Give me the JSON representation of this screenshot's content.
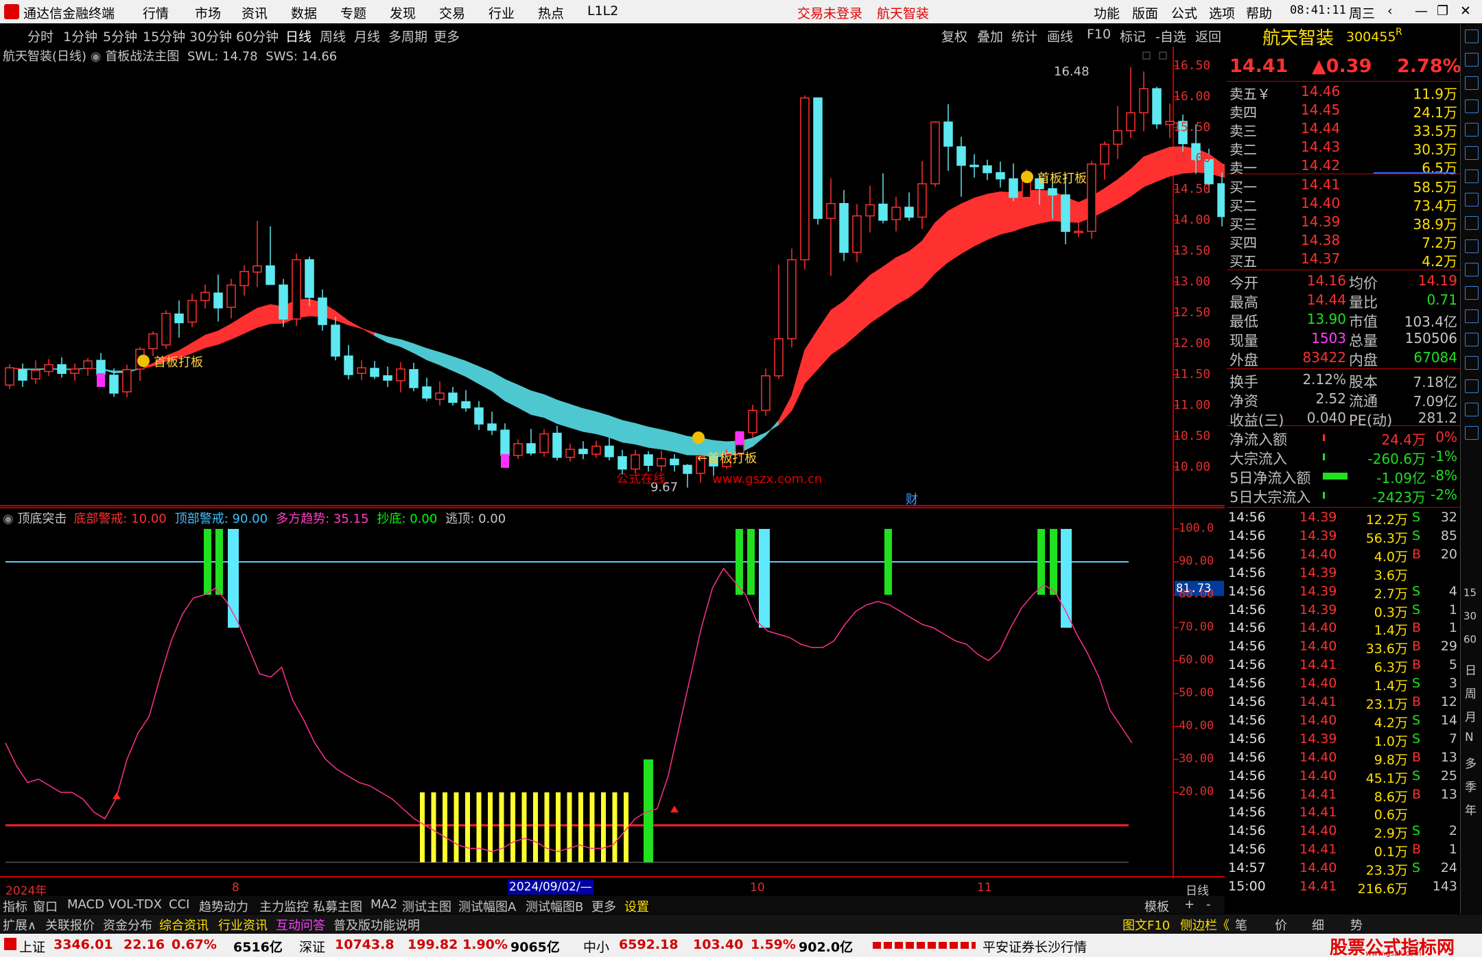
{
  "titlebar": {
    "app": "通达信金融终端",
    "menu": [
      "行情",
      "市场",
      "资讯",
      "数据",
      "专题",
      "发现",
      "交易",
      "行业",
      "热点",
      "L1L2"
    ],
    "trade_status": "交易未登录",
    "stock_name": "航天智装",
    "right_menu": [
      "功能",
      "版面",
      "公式",
      "选项",
      "帮助"
    ],
    "time": "08:41:11",
    "weekday": "周三"
  },
  "periods": [
    "分时",
    "1分钟",
    "5分钟",
    "15分钟",
    "30分钟",
    "60分钟",
    "日线",
    "周线",
    "月线",
    "多周期",
    "更多"
  ],
  "tools": [
    "复权",
    "叠加",
    "统计",
    "画线",
    "F10",
    "标记",
    "-自选",
    "返回"
  ],
  "chart": {
    "title": "航天智装(日线)",
    "formula": "首板战法主图",
    "swl": "SWL: 14.78",
    "sws": "SWS: 14.66",
    "high_label": "16.48",
    "low_label": "9.67",
    "signal": "首板打板",
    "signal_left": "←首板打板",
    "watermark_cn": "公式在线",
    "watermark_url": "www.gszx.com.cn",
    "cai": "财",
    "price_axis": [
      "16.50",
      "16.00",
      "15.50",
      "15.00",
      "14.50",
      "14.00",
      "13.50",
      "13.00",
      "12.50",
      "12.00",
      "11.50",
      "11.00",
      "10.50",
      "10.00"
    ]
  },
  "indicator": {
    "name": "顶底突击",
    "vals": [
      {
        "t": "底部警戒: 10.00",
        "c": "#ff3030"
      },
      {
        "t": "顶部警戒: 90.00",
        "c": "#40c0ff"
      },
      {
        "t": "多方趋势: 35.15",
        "c": "#ff40c0"
      },
      {
        "t": "抄底: 0.00",
        "c": "#00ff00"
      },
      {
        "t": "逃顶: 0.00",
        "c": "#c8c8c8"
      }
    ],
    "axis": [
      "100.0",
      "90.00",
      "80.00",
      "70.00",
      "60.00",
      "50.00",
      "40.00",
      "30.00",
      "20.00"
    ],
    "current": "81.73"
  },
  "dates": {
    "year": "2024年",
    "m8": "8",
    "sel": "2024/09/02/—",
    "m10": "10",
    "m11": "11",
    "period": "日线"
  },
  "tabs": [
    "指标",
    "窗口",
    "MACD",
    "VOL-TDX",
    "CCI",
    "趋势动力",
    "主力监控",
    "私募主图",
    "MA2",
    "测试主图",
    "测试幅图A",
    "测试幅图B",
    "更多",
    "设置"
  ],
  "tabs_right": [
    "模板",
    "+",
    "-"
  ],
  "bottom_tabs": [
    "扩展∧",
    "关联报价",
    "资金分布",
    "综合资讯",
    "行业资讯",
    "互动问答",
    "普及版功能说明"
  ],
  "bottom_right": [
    "图文F10",
    "侧边栏《",
    "笔",
    "价",
    "细",
    "势"
  ],
  "indices": [
    {
      "n": "上证",
      "v": "3346.01",
      "c": "22.16",
      "p": "0.67%",
      "a": "6516亿"
    },
    {
      "n": "深证",
      "v": "10743.8",
      "c": "199.82",
      "p": "1.90%",
      "a": "9065亿"
    },
    {
      "n": "中小",
      "v": "6592.18",
      "c": "103.40",
      "p": "1.59%",
      "a": "902.0亿"
    }
  ],
  "broker": "平安证券长沙行情",
  "logo": {
    "cn": "股票公式指标网",
    "url": "www.gszx.com"
  },
  "quote": {
    "name": "航天智装",
    "code": "300455",
    "flag": "R",
    "price": "14.41",
    "change": "▲0.39",
    "pct": "2.78%",
    "sells": [
      {
        "l": "卖五￥",
        "p": "14.46",
        "v": "11.9万"
      },
      {
        "l": "卖四",
        "p": "14.45",
        "v": "24.1万"
      },
      {
        "l": "卖三",
        "p": "14.44",
        "v": "33.5万"
      },
      {
        "l": "卖二",
        "p": "14.43",
        "v": "30.3万"
      },
      {
        "l": "卖一",
        "p": "14.42",
        "v": "6.5万"
      }
    ],
    "buys": [
      {
        "l": "买一",
        "p": "14.41",
        "v": "58.5万"
      },
      {
        "l": "买二",
        "p": "14.40",
        "v": "73.4万"
      },
      {
        "l": "买三",
        "p": "14.39",
        "v": "38.9万"
      },
      {
        "l": "买四",
        "p": "14.38",
        "v": "7.2万"
      },
      {
        "l": "买五",
        "p": "14.37",
        "v": "4.2万"
      }
    ],
    "stats": [
      [
        "今开",
        "14.16",
        "均价",
        "14.19"
      ],
      [
        "最高",
        "14.44",
        "量比",
        "0.71"
      ],
      [
        "最低",
        "13.90",
        "市值",
        "103.4亿"
      ],
      [
        "现量",
        "1503",
        "总量",
        "150506"
      ],
      [
        "外盘",
        "83422",
        "内盘",
        "67084"
      ]
    ],
    "stats2": [
      [
        "换手",
        "2.12%",
        "股本",
        "7.18亿"
      ],
      [
        "净资",
        "2.52",
        "流通",
        "7.09亿"
      ],
      [
        "收益(三)",
        "0.040",
        "PE(动)",
        "281.2"
      ]
    ],
    "flows": [
      [
        "净流入额",
        "24.4万",
        "0%"
      ],
      [
        "大宗流入",
        "-260.6万",
        "-1%"
      ],
      [
        "5日净流入额",
        "-1.09亿",
        "-8%"
      ],
      [
        "5日大宗流入",
        "-2423万",
        "-2%"
      ]
    ],
    "ticks": [
      [
        "14:56",
        "14.39",
        "12.2万",
        "S",
        "32"
      ],
      [
        "14:56",
        "14.39",
        "56.3万",
        "S",
        "85"
      ],
      [
        "14:56",
        "14.40",
        "4.0万",
        "B",
        "20"
      ],
      [
        "14:56",
        "14.39",
        "3.6万",
        "",
        ""
      ],
      [
        "14:56",
        "14.39",
        "2.7万",
        "S",
        "4"
      ],
      [
        "14:56",
        "14.39",
        "0.3万",
        "S",
        "1"
      ],
      [
        "14:56",
        "14.40",
        "1.4万",
        "B",
        "1"
      ],
      [
        "14:56",
        "14.40",
        "33.6万",
        "B",
        "29"
      ],
      [
        "14:56",
        "14.41",
        "6.3万",
        "B",
        "5"
      ],
      [
        "14:56",
        "14.40",
        "1.4万",
        "S",
        "3"
      ],
      [
        "14:56",
        "14.41",
        "23.1万",
        "B",
        "12"
      ],
      [
        "14:56",
        "14.40",
        "4.2万",
        "S",
        "14"
      ],
      [
        "14:56",
        "14.39",
        "1.0万",
        "S",
        "7"
      ],
      [
        "14:56",
        "14.40",
        "9.8万",
        "B",
        "13"
      ],
      [
        "14:56",
        "14.40",
        "45.1万",
        "S",
        "25"
      ],
      [
        "14:56",
        "14.41",
        "8.6万",
        "B",
        "13"
      ],
      [
        "14:56",
        "14.41",
        "0.6万",
        "",
        ""
      ],
      [
        "14:56",
        "14.40",
        "2.9万",
        "S",
        "2"
      ],
      [
        "14:56",
        "14.41",
        "0.1万",
        "B",
        "1"
      ],
      [
        "14:57",
        "14.40",
        "23.3万",
        "S",
        "24"
      ],
      [
        "15:00",
        "14.41",
        "216.6万",
        "",
        "143"
      ]
    ]
  },
  "side_icons": [
    "日",
    "周",
    "月",
    "N",
    "多",
    "季",
    "年"
  ],
  "side_nums": [
    "15",
    "30",
    "60"
  ],
  "chart_data": {
    "type": "candlestick",
    "series": [
      [
        11.33,
        11.67,
        11.27,
        11.61
      ],
      [
        11.58,
        11.68,
        11.3,
        11.41
      ],
      [
        11.43,
        11.73,
        11.35,
        11.57
      ],
      [
        11.55,
        11.75,
        11.48,
        11.66
      ],
      [
        11.66,
        11.78,
        11.45,
        11.52
      ],
      [
        11.52,
        11.68,
        11.4,
        11.59
      ],
      [
        11.6,
        11.77,
        11.48,
        11.72
      ],
      [
        11.73,
        11.85,
        11.41,
        11.5
      ],
      [
        11.49,
        11.6,
        11.14,
        11.2
      ],
      [
        11.22,
        11.66,
        11.13,
        11.58
      ],
      [
        11.59,
        11.95,
        11.4,
        11.91
      ],
      [
        11.92,
        12.2,
        11.8,
        12.16
      ],
      [
        11.98,
        12.54,
        11.92,
        12.49
      ],
      [
        12.48,
        12.7,
        12.1,
        12.34
      ],
      [
        12.35,
        12.81,
        12.27,
        12.7
      ],
      [
        12.7,
        12.96,
        12.57,
        12.83
      ],
      [
        12.82,
        13.12,
        12.36,
        12.58
      ],
      [
        12.59,
        13.05,
        12.41,
        12.95
      ],
      [
        12.94,
        13.27,
        12.78,
        13.17
      ],
      [
        13.16,
        13.99,
        12.92,
        13.26
      ],
      [
        13.26,
        13.9,
        13.18,
        12.96
      ],
      [
        12.95,
        13.05,
        12.27,
        12.4
      ],
      [
        12.4,
        13.46,
        12.29,
        13.36
      ],
      [
        13.36,
        13.41,
        12.61,
        12.75
      ],
      [
        12.74,
        12.88,
        12.21,
        12.31
      ],
      [
        12.3,
        12.44,
        11.73,
        11.8
      ],
      [
        11.8,
        11.98,
        11.42,
        11.5
      ],
      [
        11.52,
        11.73,
        11.41,
        11.61
      ],
      [
        11.6,
        11.72,
        11.43,
        11.47
      ],
      [
        11.48,
        11.63,
        11.3,
        11.41
      ],
      [
        11.4,
        11.7,
        11.21,
        11.59
      ],
      [
        11.58,
        11.69,
        11.23,
        11.29
      ],
      [
        11.3,
        11.45,
        11.07,
        11.12
      ],
      [
        11.1,
        11.39,
        11.0,
        11.2
      ],
      [
        11.2,
        11.3,
        11.0,
        11.05
      ],
      [
        11.06,
        11.25,
        10.9,
        10.96
      ],
      [
        10.96,
        11.07,
        10.6,
        10.7
      ],
      [
        10.7,
        10.9,
        10.52,
        10.6
      ],
      [
        10.6,
        10.71,
        10.1,
        10.19
      ],
      [
        10.19,
        10.45,
        10.13,
        10.38
      ],
      [
        10.38,
        10.62,
        10.19,
        10.23
      ],
      [
        10.24,
        10.62,
        10.17,
        10.54
      ],
      [
        10.55,
        10.67,
        10.11,
        10.16
      ],
      [
        10.16,
        10.38,
        10.09,
        10.29
      ],
      [
        10.29,
        10.42,
        10.13,
        10.22
      ],
      [
        10.21,
        10.43,
        10.15,
        10.34
      ],
      [
        10.34,
        10.48,
        10.11,
        10.17
      ],
      [
        10.17,
        10.28,
        9.88,
        9.97
      ],
      [
        9.97,
        10.28,
        9.9,
        10.2
      ],
      [
        10.2,
        10.26,
        9.93,
        10.03
      ],
      [
        10.02,
        10.27,
        9.93,
        10.14
      ],
      [
        10.13,
        10.21,
        9.93,
        10.04
      ],
      [
        10.03,
        10.05,
        9.67,
        9.9
      ],
      [
        9.9,
        10.21,
        9.75,
        10.17
      ],
      [
        10.17,
        10.2,
        9.86,
        10.02
      ],
      [
        10.01,
        10.29,
        9.97,
        10.21
      ],
      [
        10.21,
        10.56,
        10.17,
        10.56
      ],
      [
        10.56,
        11.01,
        10.48,
        10.92
      ],
      [
        10.92,
        11.6,
        10.83,
        11.48
      ],
      [
        11.48,
        13.28,
        11.43,
        12.08
      ],
      [
        12.08,
        13.54,
        11.94,
        13.36
      ],
      [
        13.36,
        16.02,
        13.2,
        15.98
      ],
      [
        15.98,
        15.15,
        13.93,
        14.03
      ],
      [
        14.03,
        14.68,
        13.1,
        14.27
      ],
      [
        14.27,
        14.49,
        13.34,
        13.48
      ],
      [
        13.48,
        14.26,
        13.32,
        14.07
      ],
      [
        14.07,
        14.56,
        13.8,
        14.25
      ],
      [
        14.26,
        14.76,
        13.95,
        14.0
      ],
      [
        14.01,
        14.38,
        13.82,
        14.21
      ],
      [
        14.21,
        14.45,
        13.99,
        14.05
      ],
      [
        14.05,
        14.96,
        13.86,
        14.59
      ],
      [
        14.59,
        15.6,
        14.54,
        15.59
      ],
      [
        15.59,
        15.88,
        14.8,
        15.2
      ],
      [
        15.19,
        15.35,
        14.38,
        14.89
      ],
      [
        14.89,
        15.07,
        14.69,
        14.88
      ],
      [
        14.88,
        14.98,
        14.65,
        14.77
      ],
      [
        14.77,
        14.95,
        14.53,
        14.67
      ],
      [
        14.67,
        14.92,
        14.31,
        14.37
      ],
      [
        14.37,
        14.83,
        14.31,
        14.67
      ],
      [
        14.67,
        14.74,
        14.25,
        14.51
      ],
      [
        14.51,
        14.75,
        14.02,
        14.41
      ],
      [
        14.41,
        14.76,
        13.61,
        13.82
      ],
      [
        13.82,
        14.1,
        13.73,
        13.82
      ],
      [
        13.82,
        14.96,
        13.7,
        14.91
      ],
      [
        14.91,
        15.28,
        14.66,
        15.23
      ],
      [
        15.23,
        15.85,
        14.99,
        15.45
      ],
      [
        15.45,
        16.48,
        15.33,
        15.74
      ],
      [
        15.74,
        16.41,
        15.44,
        16.13
      ],
      [
        16.13,
        16.16,
        15.48,
        15.56
      ],
      [
        15.55,
        15.89,
        15.33,
        15.6
      ],
      [
        15.6,
        15.71,
        15.11,
        15.24
      ],
      [
        15.24,
        15.55,
        14.75,
        14.98
      ],
      [
        14.98,
        15.16,
        14.45,
        14.59
      ],
      [
        14.59,
        14.77,
        13.9,
        14.06
      ],
      [
        14.16,
        14.44,
        13.9,
        14.41
      ]
    ]
  }
}
